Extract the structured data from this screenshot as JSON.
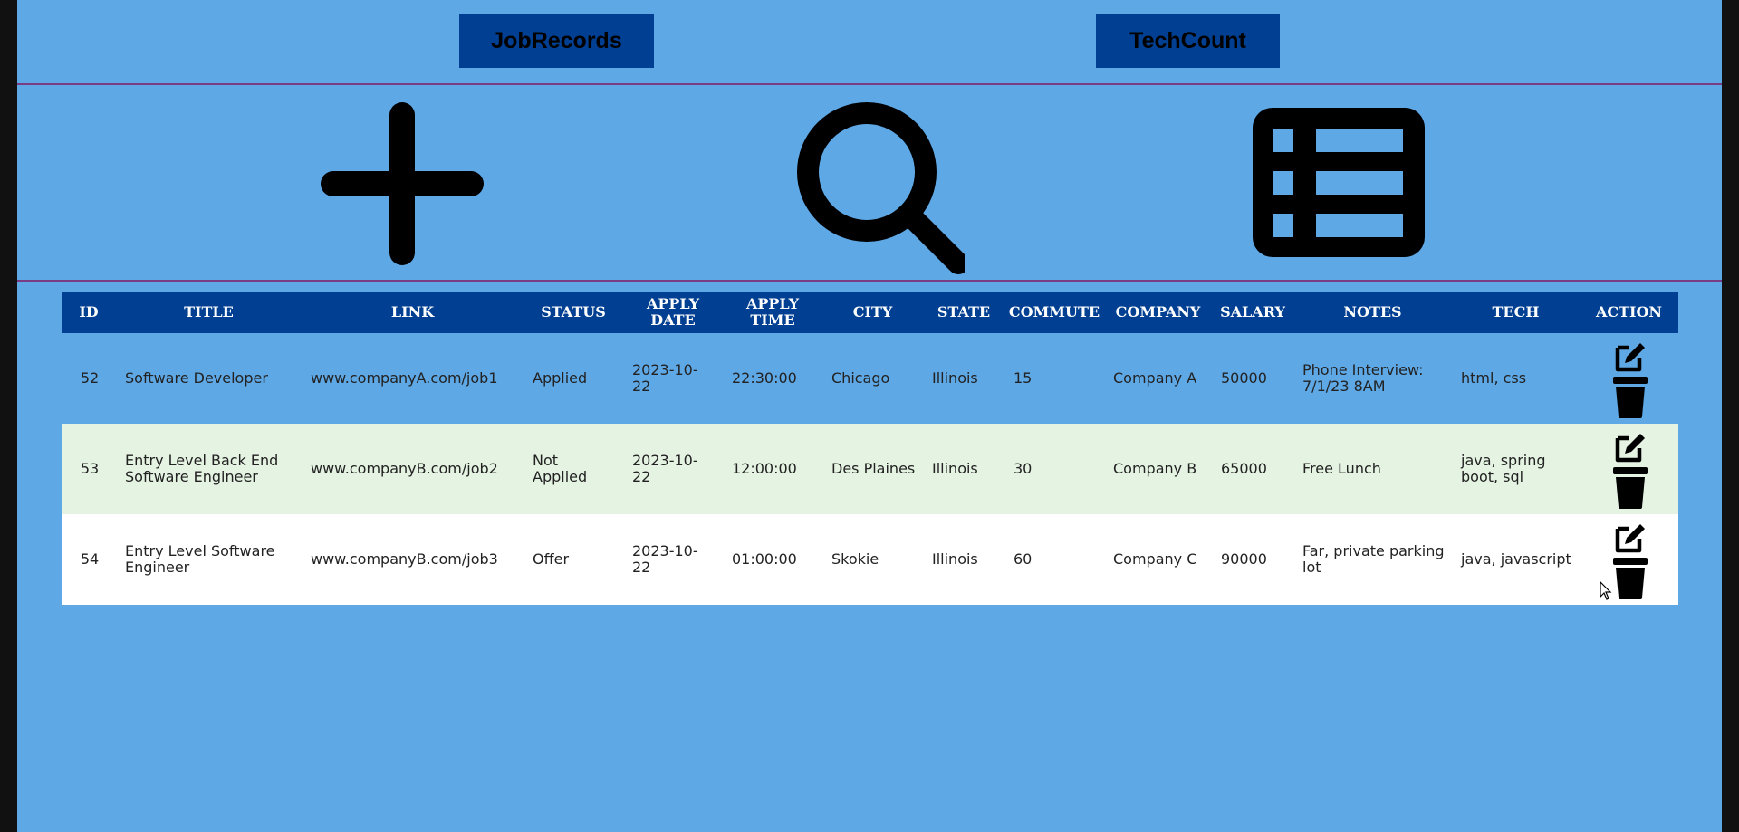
{
  "nav": {
    "jobrecords_label": "JobRecords",
    "techcount_label": "TechCount"
  },
  "toolbar_icons": [
    "plus-icon",
    "search-icon",
    "table-icon"
  ],
  "colors": {
    "page_bg": "#5ea8e6",
    "header_bg": "#003f91",
    "divider": "#7a3d83",
    "row_alt_bg": "#e5f3e2",
    "row_white_bg": "#ffffff"
  },
  "table": {
    "headers": {
      "id": "ID",
      "title": "TITLE",
      "link": "LINK",
      "status": "STATUS",
      "apply_date": "APPLY DATE",
      "apply_time": "APPLY TIME",
      "city": "CITY",
      "state": "STATE",
      "commute": "COMMUTE",
      "company": "COMPANY",
      "salary": "SALARY",
      "notes": "NOTES",
      "tech": "TECH",
      "action": "ACTION"
    },
    "rows": [
      {
        "id": "52",
        "title": "Software Developer",
        "link": "www.companyA.com/job1",
        "status": "Applied",
        "apply_date": "2023-10-22",
        "apply_time": "22:30:00",
        "city": "Chicago",
        "state": "Illinois",
        "commute": "15",
        "company": "Company A",
        "salary": "50000",
        "notes": "Phone Interview: 7/1/23 8AM",
        "tech": "html, css"
      },
      {
        "id": "53",
        "title": "Entry Level Back End Software Engineer",
        "link": "www.companyB.com/job2",
        "status": "Not Applied",
        "apply_date": "2023-10-22",
        "apply_time": "12:00:00",
        "city": "Des Plaines",
        "state": "Illinois",
        "commute": "30",
        "company": "Company B",
        "salary": "65000",
        "notes": "Free Lunch",
        "tech": "java, spring boot, sql"
      },
      {
        "id": "54",
        "title": "Entry Level Software Engineer",
        "link": "www.companyB.com/job3",
        "status": "Offer",
        "apply_date": "2023-10-22",
        "apply_time": "01:00:00",
        "city": "Skokie",
        "state": "Illinois",
        "commute": "60",
        "company": "Company C",
        "salary": "90000",
        "notes": "Far, private parking lot",
        "tech": "java, javascript"
      }
    ]
  }
}
